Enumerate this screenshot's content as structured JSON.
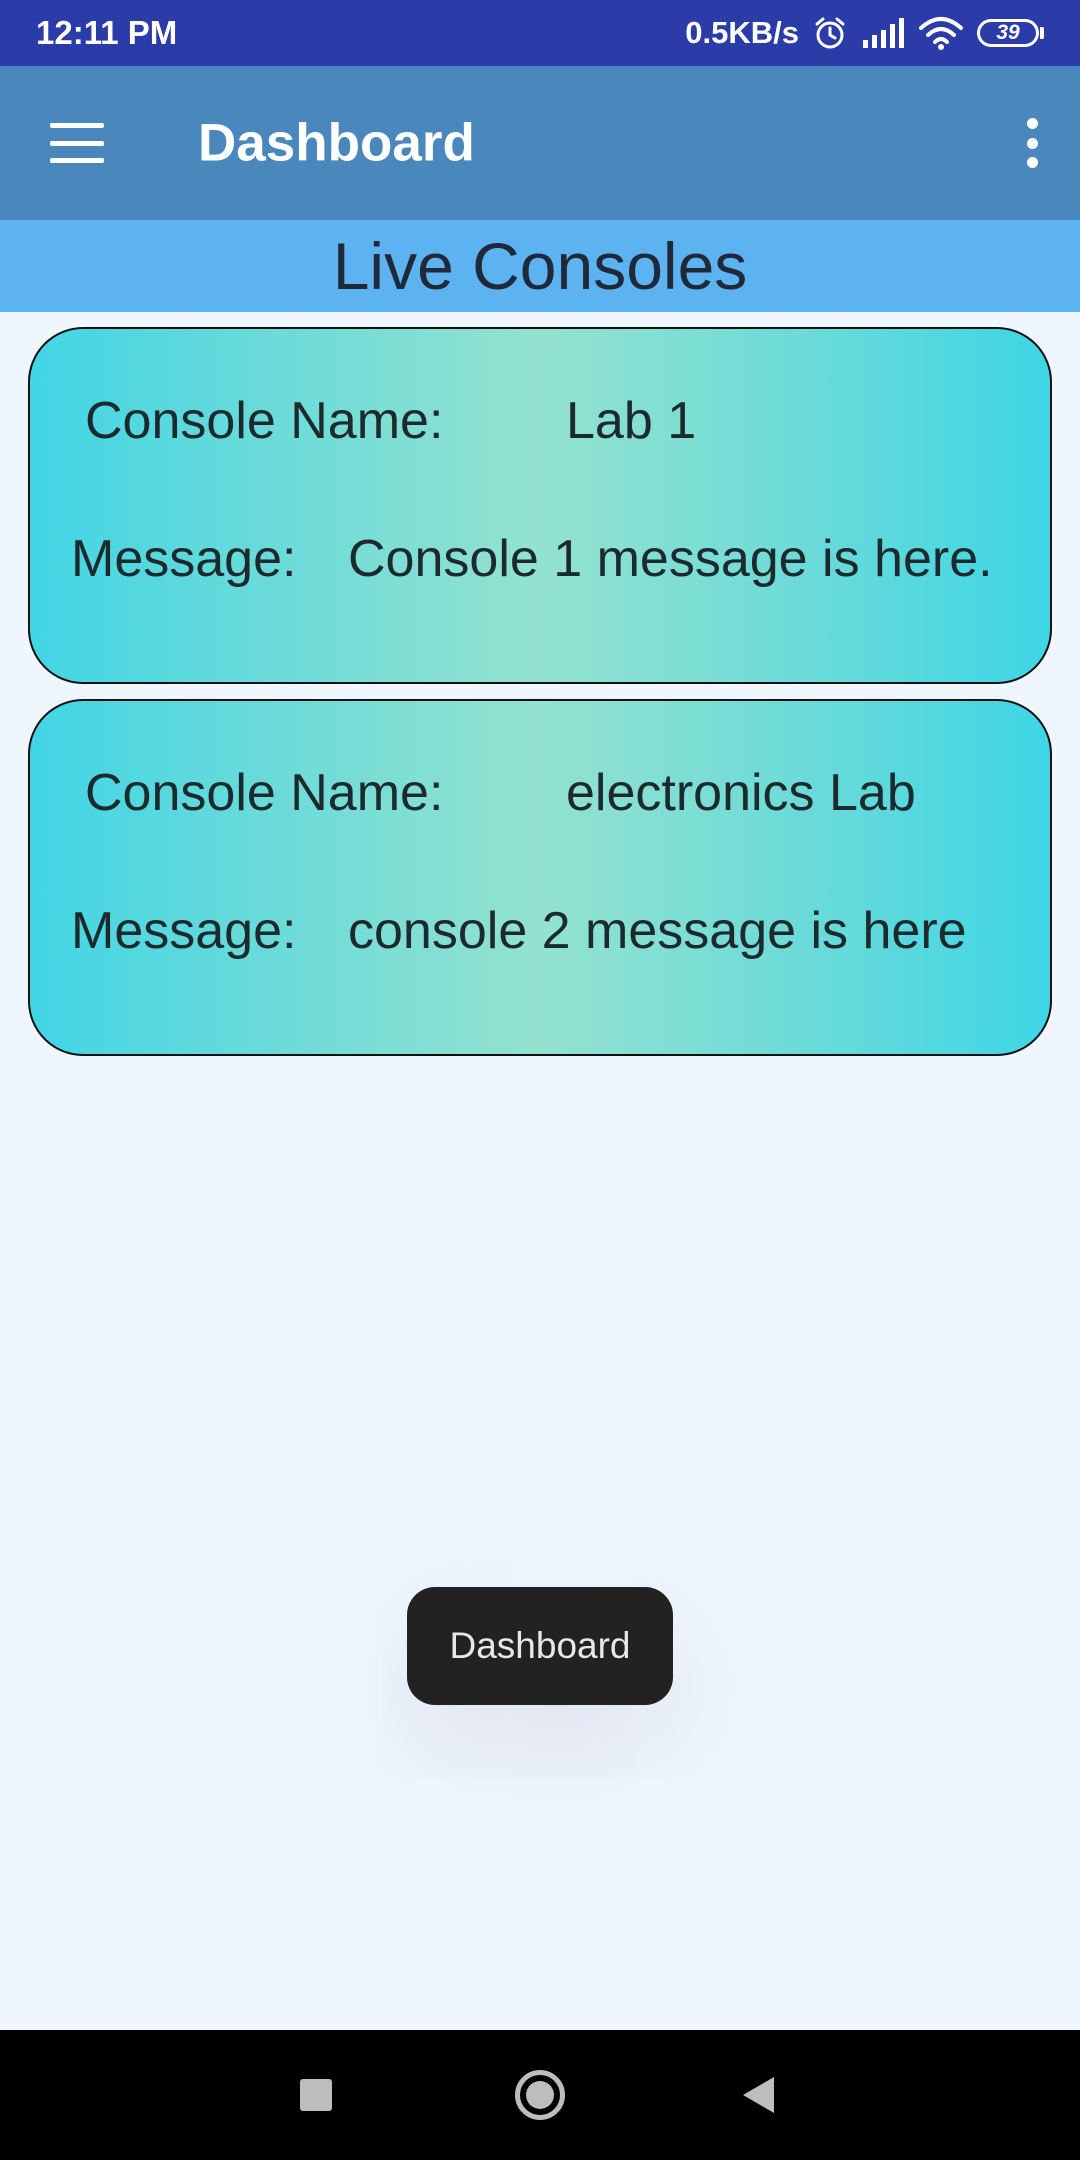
{
  "status_bar": {
    "time": "12:11 PM",
    "network_speed": "0.5KB/s",
    "battery_level": "39",
    "icons": [
      "alarm-icon",
      "signal-icon",
      "wifi-icon",
      "battery-icon"
    ]
  },
  "app_bar": {
    "title": "Dashboard",
    "icons": [
      "menu-icon",
      "more-vert-icon"
    ]
  },
  "section": {
    "title": "Live Consoles"
  },
  "consoles": [
    {
      "name_label": "Console Name:",
      "name_value": "Lab 1",
      "message_label": "Message:",
      "message_value": "Console 1 message is here."
    },
    {
      "name_label": "Console Name:",
      "name_value": "electronics Lab",
      "message_label": "Message:",
      "message_value": "console 2 message is here"
    }
  ],
  "toast": {
    "text": "Dashboard"
  },
  "nav_bar": {
    "icons": [
      "recents-icon",
      "home-icon",
      "back-icon"
    ]
  },
  "colors": {
    "status_bar": "#2B3BA8",
    "app_bar": "#4A87BD",
    "section_header": "#5DB3EF",
    "background": "#F0F6FE",
    "card_gradient_edge": "#41D5E5",
    "card_gradient_center": "#93E2CF",
    "toast": "#222222"
  }
}
